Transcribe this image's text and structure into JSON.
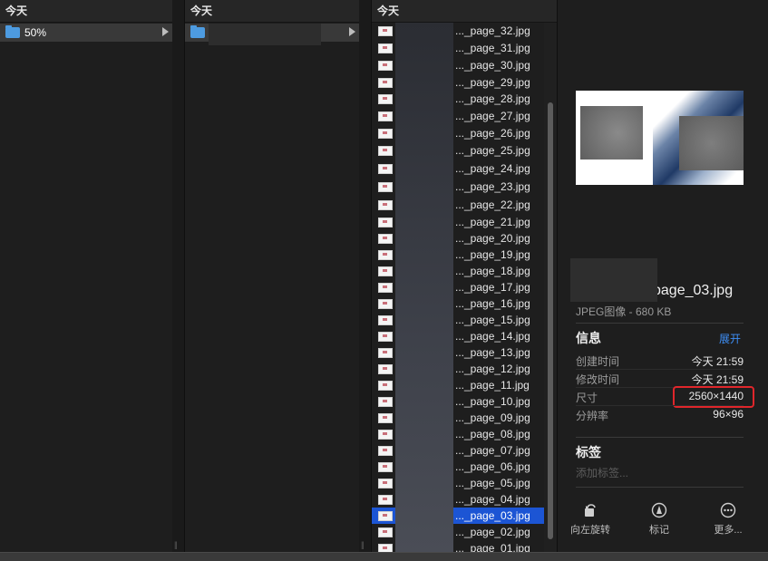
{
  "columns": [
    {
      "header": "今天",
      "items": [
        {
          "label": "50%"
        }
      ]
    },
    {
      "header": "今天",
      "items": [
        {
          "label": ""
        }
      ]
    },
    {
      "header": "今天"
    }
  ],
  "files": [
    "..._page_32.jpg",
    "..._page_31.jpg",
    "..._page_30.jpg",
    "..._page_29.jpg",
    "..._page_28.jpg",
    "..._page_27.jpg",
    "..._page_26.jpg",
    "..._page_25.jpg",
    "..._page_24.jpg",
    "..._page_23.jpg",
    "..._page_22.jpg",
    "..._page_21.jpg",
    "..._page_20.jpg",
    "..._page_19.jpg",
    "..._page_18.jpg",
    "..._page_17.jpg",
    "..._page_16.jpg",
    "..._page_15.jpg",
    "..._page_14.jpg",
    "..._page_13.jpg",
    "..._page_12.jpg",
    "..._page_11.jpg",
    "..._page_10.jpg",
    "..._page_09.jpg",
    "..._page_08.jpg",
    "..._page_07.jpg",
    "..._page_06.jpg",
    "..._page_05.jpg",
    "..._page_04.jpg",
    "..._page_03.jpg",
    "..._page_02.jpg",
    "..._page_01.jpg"
  ],
  "selected_file": "..._page_03.jpg",
  "preview": {
    "file_name": "page_03.jpg",
    "kind_size": "JPEG图像 - 680 KB",
    "info_title": "信息",
    "expand_label": "展开",
    "info_rows": [
      {
        "key": "创建时间",
        "value": "今天 21:59"
      },
      {
        "key": "修改时间",
        "value": "今天 21:59"
      },
      {
        "key": "尺寸",
        "value": "2560×1440"
      },
      {
        "key": "分辨率",
        "value": "96×96"
      }
    ],
    "tags_title": "标签",
    "tags_placeholder": "添加标签...",
    "actions": [
      {
        "label": "向左旋转",
        "icon": "rotate-left-icon"
      },
      {
        "label": "标记",
        "icon": "markup-icon"
      },
      {
        "label": "更多...",
        "icon": "more-icon"
      }
    ]
  },
  "colors": {
    "selection": "#1c55d4",
    "link": "#3d8ef5",
    "highlight": "#e0262b",
    "folder": "#4d9be0"
  }
}
